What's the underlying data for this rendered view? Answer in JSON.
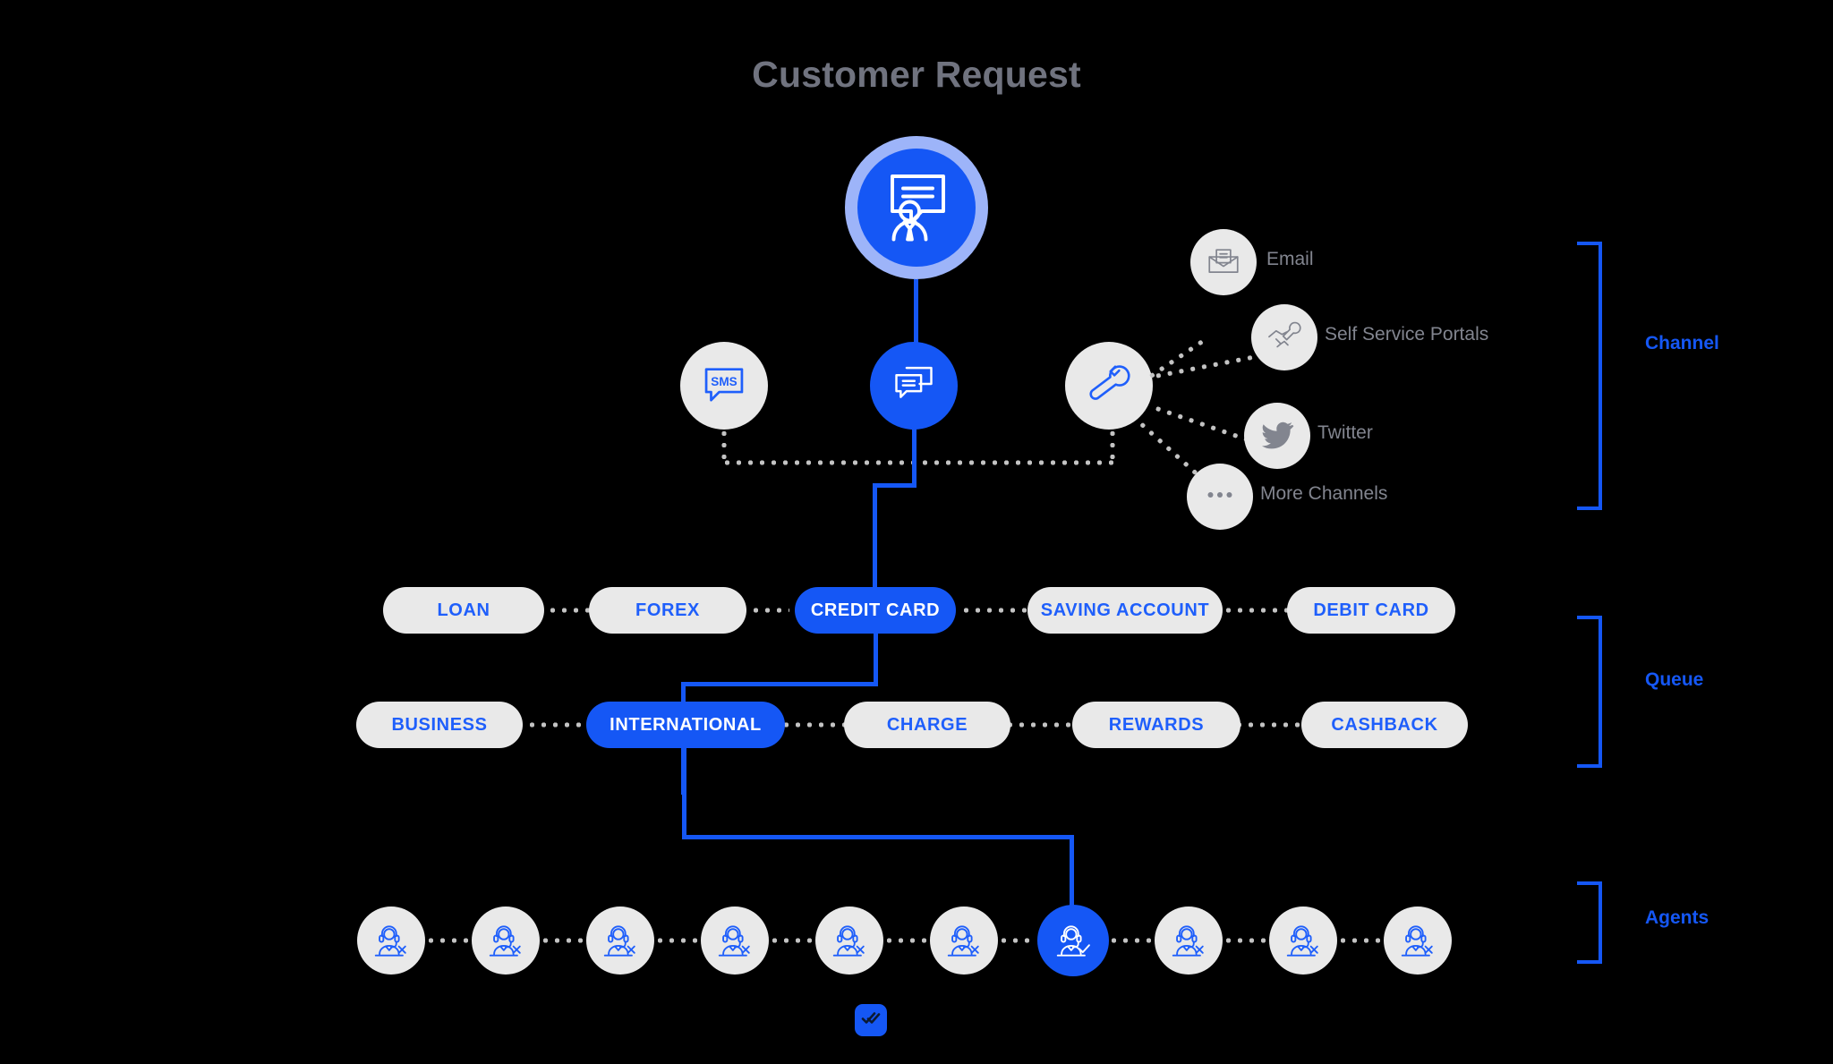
{
  "title": "Customer Request",
  "colors": {
    "accent": "#1557f5",
    "accent_light": "#9db4f9",
    "pill_bg": "#e9e9e9",
    "pill_text": "#1f5ffb",
    "label_grey": "#82858f",
    "title_grey": "#70737f",
    "dotted_grey": "#c3c3c3",
    "background": "#000000"
  },
  "hero": {
    "icon": "customer-request-icon",
    "state": "active"
  },
  "channel": {
    "section_label": "Channel",
    "nodes": [
      {
        "id": "sms",
        "icon": "sms-bubble-icon",
        "label": "SMS",
        "state": "inactive"
      },
      {
        "id": "chat",
        "icon": "chat-bubbles-icon",
        "label": "",
        "state": "active"
      },
      {
        "id": "hub",
        "icon": "wrench-icon",
        "label": "",
        "state": "inactive"
      }
    ],
    "items": [
      {
        "id": "email",
        "icon": "envelope-icon",
        "label": "Email"
      },
      {
        "id": "portal",
        "icon": "handshake-wrench-icon",
        "label": "Self Service Portals"
      },
      {
        "id": "twitter",
        "icon": "twitter-bird-icon",
        "label": "Twitter"
      },
      {
        "id": "more",
        "icon": "ellipsis-icon",
        "label": "More Channels"
      }
    ]
  },
  "queue": {
    "section_label": "Queue",
    "row1": [
      {
        "label": "LOAN",
        "state": "inactive"
      },
      {
        "label": "FOREX",
        "state": "inactive"
      },
      {
        "label": "CREDIT CARD",
        "state": "active"
      },
      {
        "label": "SAVING ACCOUNT",
        "state": "inactive"
      },
      {
        "label": "DEBIT CARD",
        "state": "inactive"
      }
    ],
    "row2": [
      {
        "label": "BUSINESS",
        "state": "inactive"
      },
      {
        "label": "INTERNATIONAL",
        "state": "active"
      },
      {
        "label": "CHARGE",
        "state": "inactive"
      },
      {
        "label": "REWARDS",
        "state": "inactive"
      },
      {
        "label": "CASHBACK",
        "state": "inactive"
      }
    ]
  },
  "agents": {
    "section_label": "Agents",
    "count": 10,
    "active_index": 6,
    "items": [
      {
        "icon": "agent-unavailable-icon",
        "state": "unavailable"
      },
      {
        "icon": "agent-unavailable-icon",
        "state": "unavailable"
      },
      {
        "icon": "agent-unavailable-icon",
        "state": "unavailable"
      },
      {
        "icon": "agent-unavailable-icon",
        "state": "unavailable"
      },
      {
        "icon": "agent-unavailable-icon",
        "state": "unavailable"
      },
      {
        "icon": "agent-unavailable-icon",
        "state": "unavailable"
      },
      {
        "icon": "agent-available-icon",
        "state": "available"
      },
      {
        "icon": "agent-unavailable-icon",
        "state": "unavailable"
      },
      {
        "icon": "agent-unavailable-icon",
        "state": "unavailable"
      },
      {
        "icon": "agent-unavailable-icon",
        "state": "unavailable"
      }
    ]
  },
  "footer": {
    "icon": "double-check-icon"
  }
}
